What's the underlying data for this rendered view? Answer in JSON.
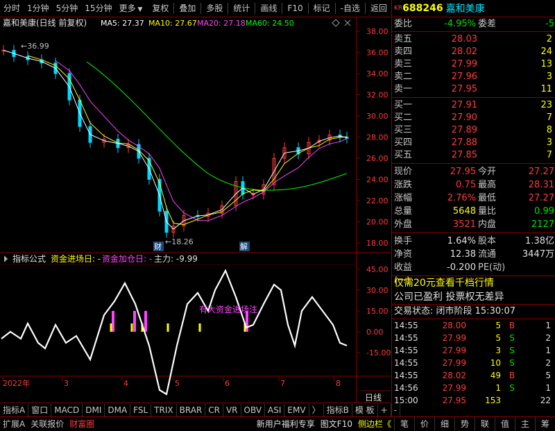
{
  "toolbar": {
    "left_tabs": [
      "分时",
      "1分钟",
      "5分钟",
      "15分钟",
      "更多"
    ],
    "right_tabs": [
      "复权",
      "叠加",
      "多股",
      "统计",
      "画线",
      "F10",
      "标记",
      "-自选",
      "返回"
    ]
  },
  "main_chart": {
    "title": "嘉和美康(日线 前复权)",
    "ma_legend": [
      {
        "label": "MA5: 27.37",
        "color": "#ffffff"
      },
      {
        "label": "MA10: 27.67",
        "color": "#ffff00"
      },
      {
        "label": "MA20: 27.18",
        "color": "#ff44ff"
      },
      {
        "label": "MA60: 24.50",
        "color": "#00ff00"
      }
    ],
    "y_ticks": [
      "38.00",
      "36.00",
      "34.00",
      "32.00",
      "30.00",
      "28.00",
      "26.00",
      "24.00",
      "22.00",
      "20.00",
      "18.00"
    ],
    "high_label": "36.99",
    "low_label": "←18.26",
    "marker_cai": "财",
    "marker_jie": "解"
  },
  "indicator": {
    "title": "指标公式",
    "item1": "资金进场日: -",
    "item2": "资金加仓日: -",
    "item3": "主力: -9.99",
    "note": "有大资金进场注",
    "y_ticks": [
      "45.00",
      "30.00",
      "15.00",
      "0.00",
      "-15.00"
    ]
  },
  "x_axis": {
    "labels": [
      "2022年",
      "3",
      "4",
      "5",
      "6",
      "7",
      "8"
    ],
    "right_label": "日线"
  },
  "bottom_tabs": [
    "指标A",
    "窗口",
    "MACD",
    "DMI",
    "DMA",
    "FSL",
    "TRIX",
    "BRAR",
    "CR",
    "VR",
    "OBV",
    "ASI",
    "EMV",
    "〉",
    "指标B",
    "模 板",
    "+",
    "-"
  ],
  "status_tabs": [
    "扩展A",
    "关联报价",
    "财富圈"
  ],
  "status_right": [
    "新用户福利专享",
    "图文F10",
    "侧边栏《"
  ],
  "right_panel": {
    "code": "688246",
    "name": "嘉和美康",
    "kr": "KR",
    "weibi_label": "委比",
    "weibi_value": "-4.95%",
    "weicha_label": "委差",
    "weicha_value": "-5",
    "asks": [
      {
        "label": "卖五",
        "price": "28.03",
        "vol": "2"
      },
      {
        "label": "卖四",
        "price": "28.02",
        "vol": "24"
      },
      {
        "label": "卖三",
        "price": "27.99",
        "vol": "13"
      },
      {
        "label": "卖二",
        "price": "27.96",
        "vol": "3"
      },
      {
        "label": "卖一",
        "price": "27.95",
        "vol": "11"
      }
    ],
    "bids": [
      {
        "label": "买一",
        "price": "27.91",
        "vol": "23"
      },
      {
        "label": "买二",
        "price": "27.90",
        "vol": "7"
      },
      {
        "label": "买三",
        "price": "27.89",
        "vol": "8"
      },
      {
        "label": "买四",
        "price": "27.88",
        "vol": "3"
      },
      {
        "label": "买五",
        "price": "27.85",
        "vol": "7"
      }
    ],
    "quotes": [
      {
        "k1": "现价",
        "v1": "27.95",
        "c1": "red",
        "k2": "今开",
        "v2": "27.27",
        "c2": "red"
      },
      {
        "k1": "涨跌",
        "v1": "0.75",
        "c1": "red",
        "k2": "最高",
        "v2": "28.31",
        "c2": "red"
      },
      {
        "k1": "涨幅",
        "v1": "2.76%",
        "c1": "red",
        "k2": "最低",
        "v2": "27.27",
        "c2": "red"
      },
      {
        "k1": "总量",
        "v1": "5648",
        "c1": "yel",
        "k2": "量比",
        "v2": "0.99",
        "c2": "green"
      },
      {
        "k1": "外盘",
        "v1": "3521",
        "c1": "red",
        "k2": "内盘",
        "v2": "2127",
        "c2": "green"
      }
    ],
    "stats": [
      {
        "k1": "换手",
        "v1": "1.64%",
        "k2": "股本",
        "v2": "1.38亿"
      },
      {
        "k1": "净资",
        "v1": "12.38",
        "k2": "流通",
        "v2": "3447万"
      },
      {
        "k1": "收益(一)",
        "v1": "-0.200",
        "k2": "PE(动)",
        "v2": ""
      }
    ],
    "promo1": "仅需20元查看千档行情",
    "promo2": "公司已盈利 投票权无差异",
    "trade_status": "交易状态: 闭市阶段 15:30:07",
    "ticks": [
      {
        "time": "14:55",
        "price": "28.00",
        "vol": "5",
        "bs": "B",
        "n": "1"
      },
      {
        "time": "14:55",
        "price": "27.99",
        "vol": "5",
        "bs": "S",
        "n": "2"
      },
      {
        "time": "14:55",
        "price": "27.99",
        "vol": "3",
        "bs": "S",
        "n": "1"
      },
      {
        "time": "14:55",
        "price": "27.99",
        "vol": "10",
        "bs": "S",
        "n": "2"
      },
      {
        "time": "14:55",
        "price": "28.02",
        "vol": "49",
        "bs": "B",
        "n": "5"
      },
      {
        "time": "14:56",
        "price": "27.99",
        "vol": "1",
        "bs": "S",
        "n": "1"
      },
      {
        "time": "15:00",
        "price": "27.95",
        "vol": "153",
        "bs": "",
        "n": "22"
      }
    ],
    "bottom_tabs": [
      "笔",
      "价",
      "细",
      "势",
      "联",
      "值",
      "主",
      "筹"
    ]
  }
}
